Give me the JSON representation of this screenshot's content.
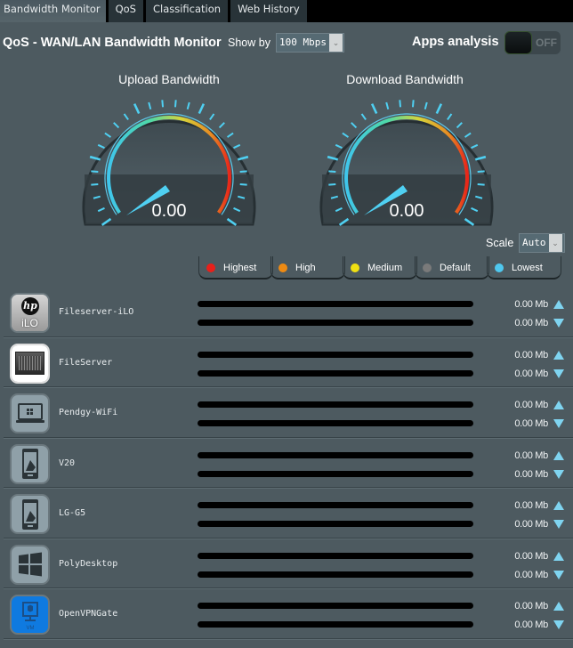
{
  "tabs": [
    {
      "label": "Bandwidth Monitor",
      "active": true
    },
    {
      "label": "QoS",
      "active": false
    },
    {
      "label": "Classification",
      "active": false
    },
    {
      "label": "Web History",
      "active": false
    }
  ],
  "header": {
    "title": "QoS - WAN/LAN Bandwidth Monitor",
    "show_by_label": "Show by",
    "show_by_value": "100 Mbps",
    "apps_analysis_label": "Apps analysis",
    "apps_analysis_state": "OFF"
  },
  "gauges": {
    "upload": {
      "title": "Upload Bandwidth",
      "value": "0.00"
    },
    "download": {
      "title": "Download Bandwidth",
      "value": "0.00"
    }
  },
  "scale": {
    "label": "Scale",
    "value": "Auto"
  },
  "legend": [
    {
      "label": "Highest",
      "color": "#e8201a"
    },
    {
      "label": "High",
      "color": "#ee8a12"
    },
    {
      "label": "Medium",
      "color": "#f0e012"
    },
    {
      "label": "Default",
      "color": "#7a7a7a"
    },
    {
      "label": "Lowest",
      "color": "#4fc8ef"
    }
  ],
  "clients": [
    {
      "name": "Fileserver-iLO",
      "icon": "hp-ilo-icon",
      "up": "0.00 Mb",
      "down": "0.00 Mb"
    },
    {
      "name": "FileServer",
      "icon": "server-icon",
      "up": "0.00 Mb",
      "down": "0.00 Mb"
    },
    {
      "name": "Pendgy-WiFi",
      "icon": "windows-laptop-icon",
      "up": "0.00 Mb",
      "down": "0.00 Mb"
    },
    {
      "name": "V20",
      "icon": "android-phone-icon",
      "up": "0.00 Mb",
      "down": "0.00 Mb"
    },
    {
      "name": "LG-G5",
      "icon": "android-phone-icon",
      "up": "0.00 Mb",
      "down": "0.00 Mb"
    },
    {
      "name": "PolyDesktop",
      "icon": "windows-icon",
      "up": "0.00 Mb",
      "down": "0.00 Mb"
    },
    {
      "name": "OpenVPNGate",
      "icon": "vm-icon",
      "up": "0.00 Mb",
      "down": "0.00 Mb"
    }
  ]
}
